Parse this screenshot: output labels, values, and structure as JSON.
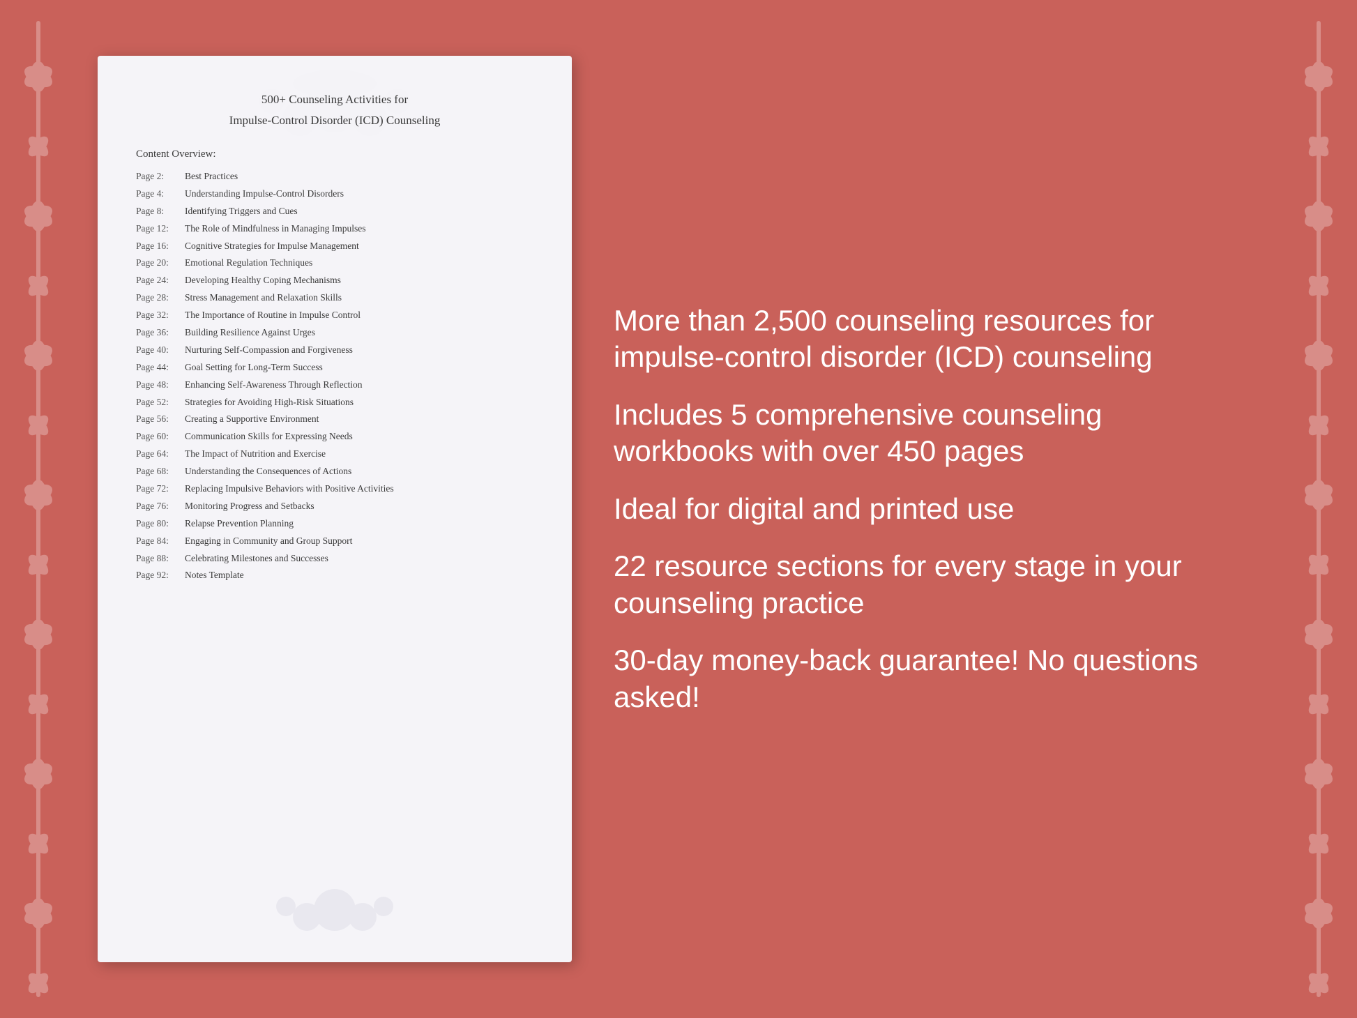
{
  "background_color": "#c9615a",
  "document": {
    "title_line1": "500+ Counseling Activities for",
    "title_line2": "Impulse-Control Disorder (ICD) Counseling",
    "overview_label": "Content Overview:",
    "toc": [
      {
        "page": "Page  2:",
        "topic": "Best Practices"
      },
      {
        "page": "Page  4:",
        "topic": "Understanding Impulse-Control Disorders"
      },
      {
        "page": "Page  8:",
        "topic": "Identifying Triggers and Cues"
      },
      {
        "page": "Page 12:",
        "topic": "The Role of Mindfulness in Managing Impulses"
      },
      {
        "page": "Page 16:",
        "topic": "Cognitive Strategies for Impulse Management"
      },
      {
        "page": "Page 20:",
        "topic": "Emotional Regulation Techniques"
      },
      {
        "page": "Page 24:",
        "topic": "Developing Healthy Coping Mechanisms"
      },
      {
        "page": "Page 28:",
        "topic": "Stress Management and Relaxation Skills"
      },
      {
        "page": "Page 32:",
        "topic": "The Importance of Routine in Impulse Control"
      },
      {
        "page": "Page 36:",
        "topic": "Building Resilience Against Urges"
      },
      {
        "page": "Page 40:",
        "topic": "Nurturing Self-Compassion and Forgiveness"
      },
      {
        "page": "Page 44:",
        "topic": "Goal Setting for Long-Term Success"
      },
      {
        "page": "Page 48:",
        "topic": "Enhancing Self-Awareness Through Reflection"
      },
      {
        "page": "Page 52:",
        "topic": "Strategies for Avoiding High-Risk Situations"
      },
      {
        "page": "Page 56:",
        "topic": "Creating a Supportive Environment"
      },
      {
        "page": "Page 60:",
        "topic": "Communication Skills for Expressing Needs"
      },
      {
        "page": "Page 64:",
        "topic": "The Impact of Nutrition and Exercise"
      },
      {
        "page": "Page 68:",
        "topic": "Understanding the Consequences of Actions"
      },
      {
        "page": "Page 72:",
        "topic": "Replacing Impulsive Behaviors with Positive Activities"
      },
      {
        "page": "Page 76:",
        "topic": "Monitoring Progress and Setbacks"
      },
      {
        "page": "Page 80:",
        "topic": "Relapse Prevention Planning"
      },
      {
        "page": "Page 84:",
        "topic": "Engaging in Community and Group Support"
      },
      {
        "page": "Page 88:",
        "topic": "Celebrating Milestones and Successes"
      },
      {
        "page": "Page 92:",
        "topic": "Notes Template"
      }
    ]
  },
  "features": [
    {
      "id": "feature1",
      "text": "More than 2,500 counseling resources for impulse-control disorder (ICD) counseling"
    },
    {
      "id": "feature2",
      "text": "Includes 5 comprehensive counseling workbooks with over 450 pages"
    },
    {
      "id": "feature3",
      "text": "Ideal for digital and printed use"
    },
    {
      "id": "feature4",
      "text": "22 resource sections for every stage in your counseling practice"
    },
    {
      "id": "feature5",
      "text": "30-day money-back guarantee! No questions asked!"
    }
  ]
}
